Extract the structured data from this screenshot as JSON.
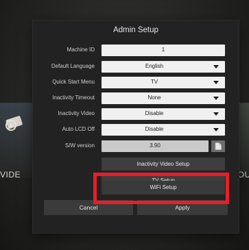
{
  "background": {
    "left_tile_label": "VIDE",
    "right_tile_label": "TOU",
    "left_icon": "video-camera-icon",
    "right_icon": "map-pin-icon"
  },
  "dialog": {
    "title": "Admin Setup",
    "fields": [
      {
        "label": "Machine ID",
        "value": "1",
        "kind": "text"
      },
      {
        "label": "Default Language",
        "value": "English",
        "kind": "dropdown"
      },
      {
        "label": "Quick Start Menu",
        "value": "TV",
        "kind": "dropdown"
      },
      {
        "label": "Inactivity Timeout",
        "value": "None",
        "kind": "dropdown"
      },
      {
        "label": "Inactivity Video",
        "value": "Disable",
        "kind": "dropdown"
      },
      {
        "label": "Auto LCD Off",
        "value": "Disable",
        "kind": "dropdown"
      },
      {
        "label": "S/W version",
        "value": "3.90",
        "kind": "readonly"
      }
    ],
    "buttons": {
      "inactivity_video_setup": "Inactivity Video Setup",
      "tv_setup": "TV Setup",
      "wifi_setup": "WiFi Setup",
      "cancel": "Cancel",
      "apply": "Apply"
    }
  },
  "colors": {
    "highlight": "#e81f28",
    "dialog_bg": "#222222",
    "field_bg": "#f0f0f0"
  }
}
